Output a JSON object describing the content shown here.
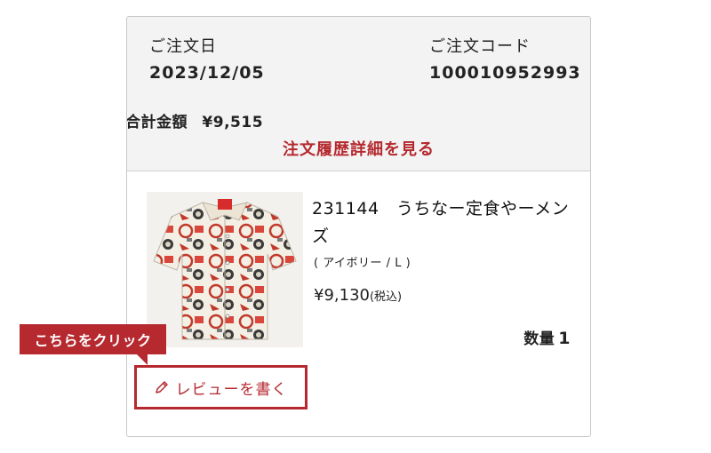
{
  "order": {
    "date_label": "ご注文日",
    "date_value": "2023/12/05",
    "code_label": "ご注文コード",
    "code_value": "100010952993",
    "total_label": "合計金額",
    "total_value": "¥9,515",
    "history_link": "注文履歴詳細を見る"
  },
  "product": {
    "name": "231144　うちなー定食やーメンズ",
    "variant": "( アイボリー / L )",
    "price": "¥9,130",
    "tax_note": "(税込)",
    "qty_label": "数量",
    "qty_value": "1",
    "image_icon": "aloha-shirt-image"
  },
  "review": {
    "button_label": "レビューを書く",
    "icon": "pencil-icon"
  },
  "callout": {
    "text": "こちらをクリック"
  },
  "colors": {
    "accent": "#b5292f",
    "summary_bg": "#f3f3f3",
    "border": "#c8c8c8"
  }
}
